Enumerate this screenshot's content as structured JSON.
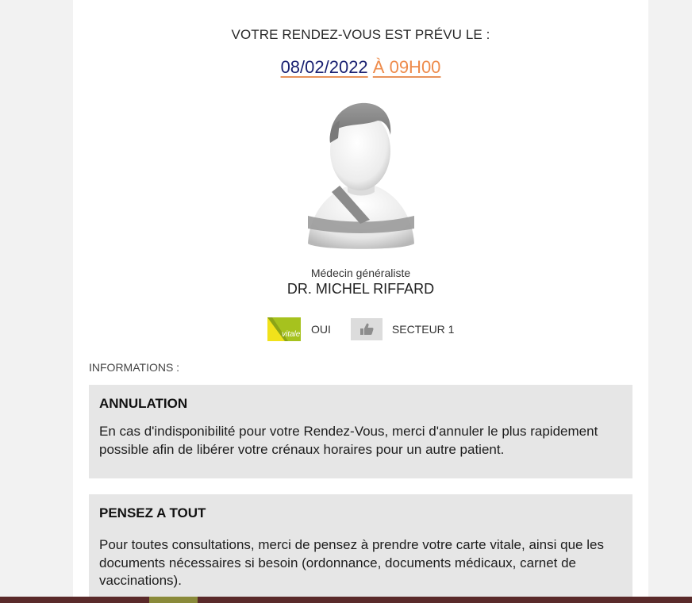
{
  "appointment": {
    "heading": "VOTRE RENDEZ-VOUS EST PRÉVU LE :",
    "date": "08/02/2022",
    "time": "À 09H00"
  },
  "doctor": {
    "specialty": "Médecin généraliste",
    "name": "DR. MICHEL RIFFARD"
  },
  "badges": {
    "vitale_icon_text": "vitale",
    "vitale_value": "OUI",
    "sector_value": "SECTEUR 1"
  },
  "informations": {
    "label": "INFORMATIONS :",
    "panels": [
      {
        "title": "ANNULATION",
        "text": "En cas d'indisponibilité pour votre Rendez-Vous, merci d'annuler le plus rapidement possible afin de libérer votre crénaux horaires pour un autre patient."
      },
      {
        "title": "PENSEZ A TOUT",
        "text": "Pour toutes consultations, merci de pensez à prendre votre carte vitale, ainsi que les documents nécessaires si besoin (ordonnance, documents médicaux, carnet de vaccinations)."
      }
    ]
  },
  "colors": {
    "date": "#1b2272",
    "time": "#ee8b4b",
    "panel_bg": "#e6e6e6",
    "footer": "#5a2a2a"
  },
  "icons": {
    "avatar": "doctor-avatar-icon",
    "vitale": "vitale-card-icon",
    "sector": "thumbs-up-icon"
  }
}
